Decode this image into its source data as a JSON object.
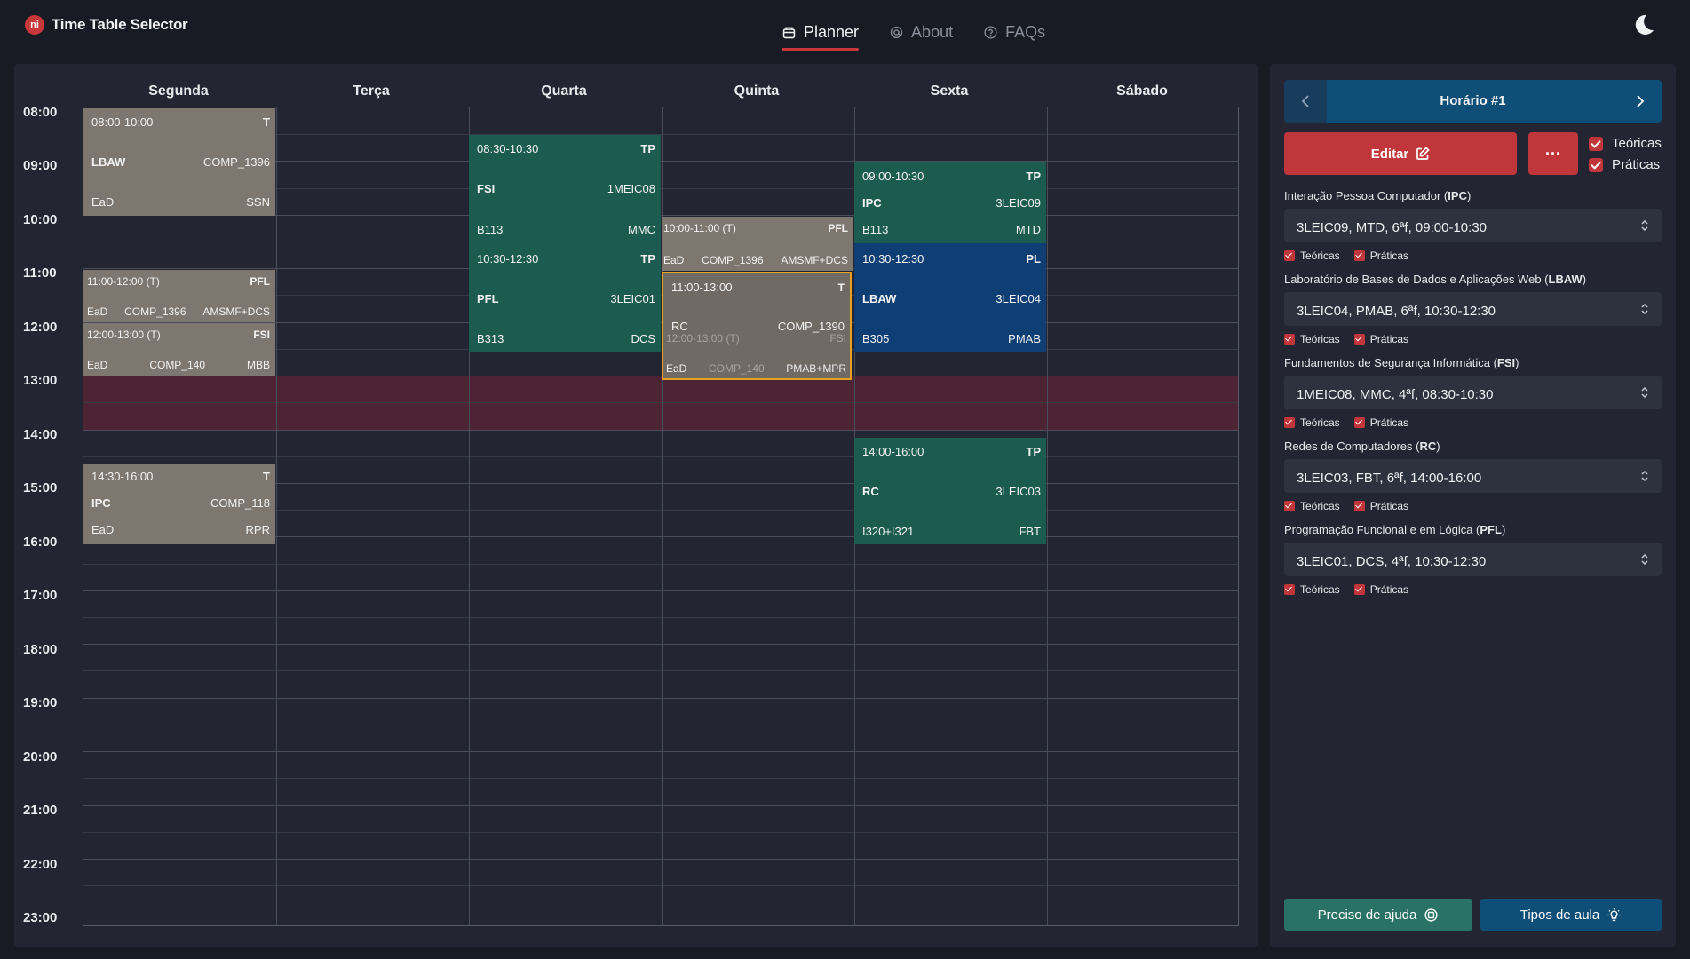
{
  "header": {
    "logo_text": "ni",
    "app_title": "Time Table Selector",
    "nav": [
      {
        "label": "Planner",
        "icon": "planner-icon",
        "active": true
      },
      {
        "label": "About",
        "icon": "at-icon",
        "active": false
      },
      {
        "label": "FAQs",
        "icon": "question-icon",
        "active": false
      }
    ],
    "theme_icon": "moon-icon"
  },
  "calendar": {
    "days": [
      "Segunda",
      "Terça",
      "Quarta",
      "Quinta",
      "Sexta",
      "Sábado"
    ],
    "hours": [
      "08:00",
      "09:00",
      "10:00",
      "11:00",
      "12:00",
      "13:00",
      "14:00",
      "15:00",
      "16:00",
      "17:00",
      "18:00",
      "19:00",
      "20:00",
      "21:00",
      "22:00",
      "23:00"
    ],
    "lunch_color": "#4c2434",
    "slots": [
      {
        "time": "08:00-10:00",
        "type": "T",
        "course": "LBAW",
        "class": "COMP_1396",
        "room": "EaD",
        "teacher": "SSN"
      },
      {
        "time": "11:00-12:00 (T)",
        "type": "PFL",
        "room": "EaD",
        "class": "COMP_1396",
        "teacher": "AMSMF+DCS"
      },
      {
        "time": "12:00-13:00 (T)",
        "type": "FSI",
        "room": "EaD",
        "class": "COMP_140",
        "teacher": "MBB"
      },
      {
        "time": "14:30-16:00",
        "type": "T",
        "course": "IPC",
        "class": "COMP_118",
        "room": "EaD",
        "teacher": "RPR"
      },
      {
        "time": "08:30-10:30",
        "type": "TP",
        "course": "FSI",
        "class": "1MEIC08",
        "room": "B113",
        "teacher": "MMC"
      },
      {
        "time": "10:30-12:30",
        "type": "TP",
        "course": "PFL",
        "class": "3LEIC01",
        "room": "B313",
        "teacher": "DCS"
      },
      {
        "time": "10:00-11:00 (T)",
        "type": "PFL",
        "room": "EaD",
        "class": "COMP_1396",
        "teacher": "AMSMF+DCS"
      },
      {
        "time": "11:00-13:00",
        "type": "T",
        "course": "RC",
        "class": "COMP_1390"
      },
      {
        "time": "12:00-13:00 (T)",
        "type": "FSI",
        "room": "EaD",
        "class": "COMP_140",
        "teacher": "PMAB+MPR"
      },
      {
        "time": "09:00-10:30",
        "type": "TP",
        "course": "IPC",
        "class": "3LEIC09",
        "room": "B113",
        "teacher": "MTD"
      },
      {
        "time": "10:30-12:30",
        "type": "PL",
        "course": "LBAW",
        "class": "3LEIC04",
        "room": "B305",
        "teacher": "PMAB"
      },
      {
        "time": "14:00-16:00",
        "type": "TP",
        "course": "RC",
        "class": "3LEIC03",
        "room": "I320+I321",
        "teacher": "FBT"
      }
    ]
  },
  "sidebar": {
    "schedule_title": "Horário #1",
    "edit_label": "Editar",
    "more_label": "···",
    "toggle_teoricas": "Teóricas",
    "toggle_praticas": "Práticas",
    "courses": [
      {
        "name": "Interação Pessoa Computador (",
        "acronym": "IPC",
        "close": ")",
        "value": "3LEIC09, MTD, 6ªf, 09:00-10:30"
      },
      {
        "name": "Laboratório de Bases de Dados e Aplicações Web (",
        "acronym": "LBAW",
        "close": ")",
        "value": "3LEIC04, PMAB, 6ªf, 10:30-12:30"
      },
      {
        "name": "Fundamentos de Segurança Informática (",
        "acronym": "FSI",
        "close": ")",
        "value": "1MEIC08, MMC, 4ªf, 08:30-10:30"
      },
      {
        "name": "Redes de Computadores (",
        "acronym": "RC",
        "close": ")",
        "value": "3LEIC03, FBT, 6ªf, 14:00-16:00"
      },
      {
        "name": "Programação Funcional e em Lógica (",
        "acronym": "PFL",
        "close": ")",
        "value": "3LEIC01, DCS, 4ªf, 10:30-12:30"
      }
    ],
    "help_label": "Preciso de ajuda",
    "types_label": "Tipos de aula"
  }
}
